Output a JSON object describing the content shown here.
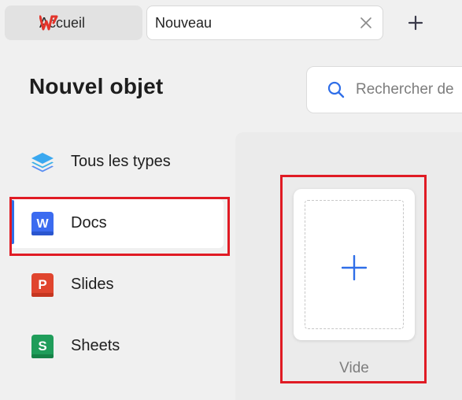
{
  "tabs": [
    {
      "label": "Accueil"
    },
    {
      "label": "Nouveau"
    }
  ],
  "page": {
    "title": "Nouvel objet"
  },
  "search": {
    "placeholder": "Rechercher de"
  },
  "sidebar": {
    "items": [
      {
        "label": "Tous les types",
        "icon": "layers-icon"
      },
      {
        "label": "Docs",
        "icon": "docs-w-icon"
      },
      {
        "label": "Slides",
        "icon": "slides-p-icon"
      },
      {
        "label": "Sheets",
        "icon": "sheets-s-icon"
      }
    ]
  },
  "templates": {
    "blank_label": "Vide"
  },
  "colors": {
    "accent": "#2f6ee8",
    "annotation": "#e01b24",
    "docs": "#3b6bf0",
    "slides": "#e0452e",
    "sheets": "#1f9d5a"
  }
}
